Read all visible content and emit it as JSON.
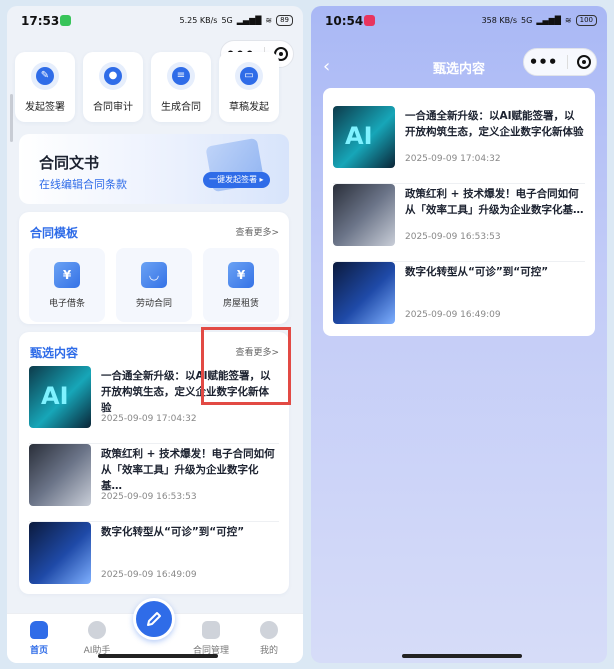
{
  "left": {
    "status": {
      "time": "17:53",
      "net": "5.25 KB/s",
      "signal": "5G",
      "battery": "89"
    },
    "quick_actions": [
      {
        "label": "发起签署",
        "icon": "pen-icon"
      },
      {
        "label": "合同审计",
        "icon": "user-check-icon"
      },
      {
        "label": "生成合同",
        "icon": "document-icon"
      },
      {
        "label": "草稿发起",
        "icon": "inbox-icon"
      }
    ],
    "banner": {
      "title": "合同文书",
      "subtitle": "在线编辑合同条款",
      "button": "一键发起签署 ▸"
    },
    "templates": {
      "title": "合同模板",
      "more": "查看更多>",
      "items": [
        {
          "label": "电子借条",
          "glyph": "¥"
        },
        {
          "label": "劳动合同",
          "glyph": "◡"
        },
        {
          "label": "房屋租赁",
          "glyph": "¥"
        }
      ]
    },
    "featured": {
      "title": "甄选内容",
      "more": "查看更多>"
    },
    "tabs": [
      {
        "label": "首页",
        "active": true
      },
      {
        "label": "AI助手",
        "active": false
      },
      {
        "label": "合同管理",
        "active": false
      },
      {
        "label": "我的",
        "active": false
      }
    ]
  },
  "right": {
    "status": {
      "time": "10:54",
      "net": "358 KB/s",
      "signal": "5G",
      "battery": "100"
    },
    "nav_title": "甄选内容",
    "back": "‹"
  },
  "articles": [
    {
      "title": "一合通全新升级：以AI赋能签署，以开放构筑生态，定义企业数字化新体验",
      "date": "2025-09-09 17:04:32"
    },
    {
      "title": "政策红利 + 技术爆发！电子合同如何从「效率工具」升级为企业数字化基…",
      "date": "2025-09-09 16:53:53"
    },
    {
      "title": "数字化转型从“可诊”到“可控”",
      "date": "2025-09-09 16:49:09"
    }
  ],
  "colors": {
    "accent": "#2f6ce8",
    "highlight": "#e24a44"
  }
}
